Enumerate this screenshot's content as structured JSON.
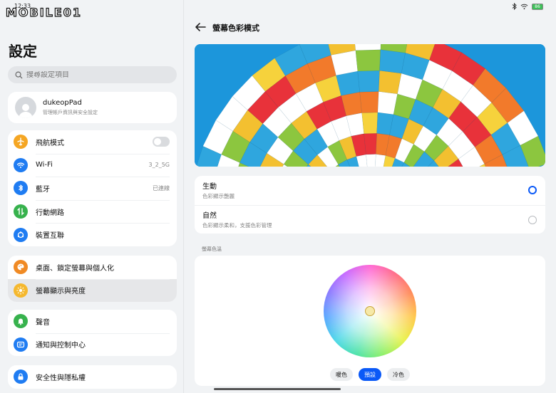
{
  "status": {
    "time": "12:33",
    "battery": "86"
  },
  "watermark": {
    "text": "MOBILE01"
  },
  "left": {
    "title": "設定",
    "search_placeholder": "搜尋設定項目",
    "account": {
      "name": "dukeopPad",
      "subtitle": "管理帳戶資訊與安全設定"
    },
    "group1": [
      {
        "label": "飛航模式",
        "value": "",
        "icon": "airplane-icon",
        "color": "#f5a623"
      },
      {
        "label": "Wi-Fi",
        "value": "3_2_5G",
        "icon": "wifi-icon",
        "color": "#1f7cf2"
      },
      {
        "label": "藍牙",
        "value": "已連線",
        "icon": "bluetooth-icon",
        "color": "#1f7cf2"
      },
      {
        "label": "行動網路",
        "value": "",
        "icon": "mobile-network-icon",
        "color": "#37b24d"
      },
      {
        "label": "裝置互聯",
        "value": "",
        "icon": "device-link-icon",
        "color": "#1f7cf2"
      }
    ],
    "group2": [
      {
        "label": "桌面、鎖定螢幕與個人化",
        "icon": "palette-icon",
        "color": "#f08a24"
      },
      {
        "label": "螢幕顯示與亮度",
        "icon": "sun-icon",
        "color": "#f5b82e"
      }
    ],
    "group3": [
      {
        "label": "聲音",
        "icon": "bell-icon",
        "color": "#37b24d"
      },
      {
        "label": "通知與控制中心",
        "icon": "notification-icon",
        "color": "#1f7cf2"
      }
    ],
    "group4": [
      {
        "label": "安全性與隱私權",
        "icon": "lock-icon",
        "color": "#1f7cf2"
      }
    ]
  },
  "right": {
    "title": "螢幕色彩模式",
    "modes": [
      {
        "name": "生動",
        "desc": "色彩顯示艷麗",
        "selected": true
      },
      {
        "name": "自然",
        "desc": "色彩顯示柔和，支援色彩管理",
        "selected": false
      }
    ],
    "section_label": "螢幕色溫",
    "temperature": {
      "warm": "暖色",
      "default": "預設",
      "cool": "冷色",
      "active": "預設"
    }
  },
  "colors": {
    "accent": "#0a59f7"
  }
}
